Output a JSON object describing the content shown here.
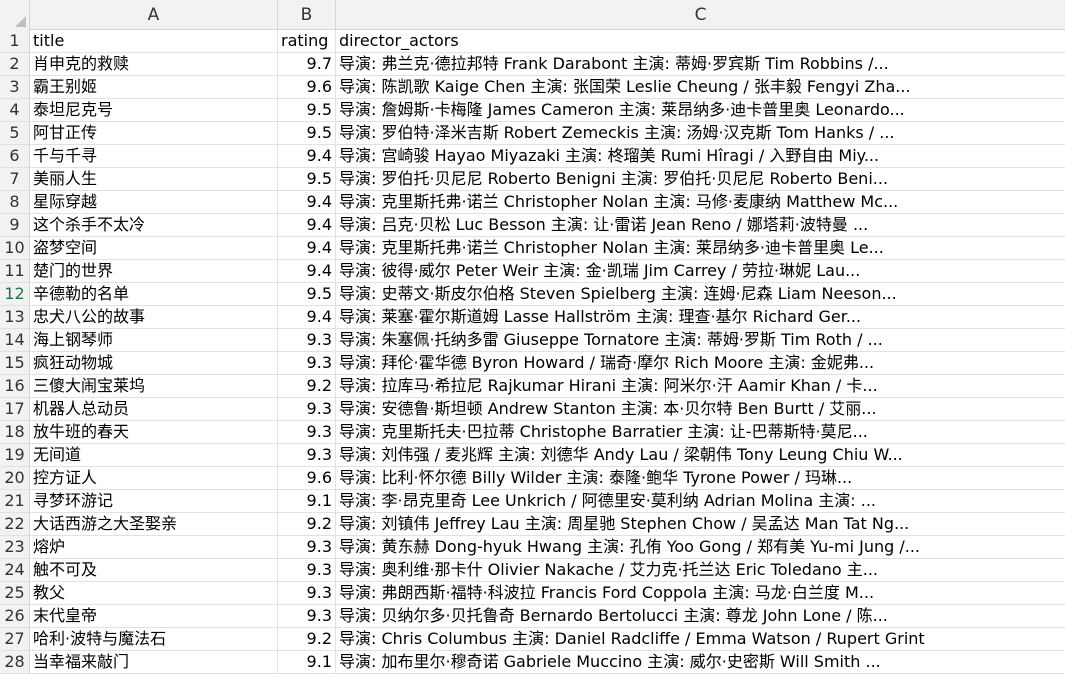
{
  "columns": [
    "A",
    "B",
    "C"
  ],
  "active_row": 12,
  "header_row": {
    "num": "1",
    "a": "title",
    "b": "rating",
    "c": "director_actors"
  },
  "rows": [
    {
      "num": "2",
      "a": "肖申克的救赎",
      "b": "9.7",
      "c": "导演: 弗兰克·德拉邦特 Frank Darabont   主演: 蒂姆·罗宾斯 Tim Robbins /..."
    },
    {
      "num": "3",
      "a": "霸王别姬",
      "b": "9.6",
      "c": "导演: 陈凯歌 Kaige Chen   主演: 张国荣 Leslie Cheung / 张丰毅 Fengyi Zha..."
    },
    {
      "num": "4",
      "a": "泰坦尼克号",
      "b": "9.5",
      "c": "导演: 詹姆斯·卡梅隆 James Cameron   主演: 莱昂纳多·迪卡普里奥 Leonardo..."
    },
    {
      "num": "5",
      "a": "阿甘正传",
      "b": "9.5",
      "c": "导演: 罗伯特·泽米吉斯 Robert Zemeckis   主演: 汤姆·汉克斯 Tom Hanks / ..."
    },
    {
      "num": "6",
      "a": "千与千寻",
      "b": "9.4",
      "c": "导演: 宫崎骏 Hayao Miyazaki   主演: 柊瑠美 Rumi Hîragi / 入野自由 Miy..."
    },
    {
      "num": "7",
      "a": "美丽人生",
      "b": "9.5",
      "c": "导演: 罗伯托·贝尼尼 Roberto Benigni   主演: 罗伯托·贝尼尼 Roberto Beni..."
    },
    {
      "num": "8",
      "a": "星际穿越",
      "b": "9.4",
      "c": "导演: 克里斯托弗·诺兰 Christopher Nolan   主演: 马修·麦康纳 Matthew Mc..."
    },
    {
      "num": "9",
      "a": "这个杀手不太冷",
      "b": "9.4",
      "c": "导演: 吕克·贝松 Luc Besson   主演: 让·雷诺 Jean Reno / 娜塔莉·波特曼 ..."
    },
    {
      "num": "10",
      "a": "盗梦空间",
      "b": "9.4",
      "c": "导演: 克里斯托弗·诺兰 Christopher Nolan   主演: 莱昂纳多·迪卡普里奥 Le..."
    },
    {
      "num": "11",
      "a": "楚门的世界",
      "b": "9.4",
      "c": "导演: 彼得·威尔 Peter Weir   主演: 金·凯瑞 Jim Carrey / 劳拉·琳妮 Lau..."
    },
    {
      "num": "12",
      "a": "辛德勒的名单",
      "b": "9.5",
      "c": "导演: 史蒂文·斯皮尔伯格 Steven Spielberg   主演: 连姆·尼森 Liam Neeson..."
    },
    {
      "num": "13",
      "a": "忠犬八公的故事",
      "b": "9.4",
      "c": "导演: 莱塞·霍尔斯道姆 Lasse Hallström   主演: 理查·基尔 Richard Ger..."
    },
    {
      "num": "14",
      "a": "海上钢琴师",
      "b": "9.3",
      "c": "导演: 朱塞佩·托纳多雷 Giuseppe Tornatore   主演: 蒂姆·罗斯 Tim Roth / ..."
    },
    {
      "num": "15",
      "a": "疯狂动物城",
      "b": "9.3",
      "c": "导演: 拜伦·霍华德 Byron Howard / 瑞奇·摩尔 Rich Moore   主演: 金妮弗..."
    },
    {
      "num": "16",
      "a": "三傻大闹宝莱坞",
      "b": "9.2",
      "c": "导演: 拉库马·希拉尼 Rajkumar Hirani   主演: 阿米尔·汗 Aamir Khan / 卡..."
    },
    {
      "num": "17",
      "a": "机器人总动员",
      "b": "9.3",
      "c": "导演: 安德鲁·斯坦顿 Andrew Stanton   主演: 本·贝尔特 Ben Burtt / 艾丽..."
    },
    {
      "num": "18",
      "a": "放牛班的春天",
      "b": "9.3",
      "c": "导演: 克里斯托夫·巴拉蒂 Christophe Barratier   主演: 让-巴蒂斯特·莫尼..."
    },
    {
      "num": "19",
      "a": "无间道",
      "b": "9.3",
      "c": "导演: 刘伟强 / 麦兆辉   主演: 刘德华 Andy Lau / 梁朝伟 Tony Leung Chiu W..."
    },
    {
      "num": "20",
      "a": "控方证人",
      "b": "9.6",
      "c": "导演: 比利·怀尔德 Billy Wilder   主演: 泰隆·鲍华 Tyrone Power / 玛琳..."
    },
    {
      "num": "21",
      "a": "寻梦环游记",
      "b": "9.1",
      "c": "导演: 李·昂克里奇 Lee Unkrich / 阿德里安·莫利纳 Adrian Molina   主演: ..."
    },
    {
      "num": "22",
      "a": "大话西游之大圣娶亲",
      "b": "9.2",
      "c": "导演: 刘镇伟 Jeffrey Lau   主演: 周星驰 Stephen Chow / 吴孟达 Man Tat Ng..."
    },
    {
      "num": "23",
      "a": "熔炉",
      "b": "9.3",
      "c": "导演: 黄东赫 Dong-hyuk Hwang   主演: 孔侑 Yoo Gong / 郑有美 Yu-mi Jung /..."
    },
    {
      "num": "24",
      "a": "触不可及",
      "b": "9.3",
      "c": "导演: 奥利维·那卡什 Olivier Nakache / 艾力克·托兰达 Eric Toledano   主..."
    },
    {
      "num": "25",
      "a": "教父",
      "b": "9.3",
      "c": "导演: 弗朗西斯·福特·科波拉 Francis Ford Coppola   主演: 马龙·白兰度 M..."
    },
    {
      "num": "26",
      "a": "末代皇帝",
      "b": "9.3",
      "c": "导演: 贝纳尔多·贝托鲁奇 Bernardo Bertolucci   主演: 尊龙 John Lone / 陈..."
    },
    {
      "num": "27",
      "a": "哈利·波特与魔法石",
      "b": "9.2",
      "c": "导演: Chris Columbus   主演: Daniel Radcliffe / Emma Watson / Rupert Grint"
    },
    {
      "num": "28",
      "a": "当幸福来敲门",
      "b": "9.1",
      "c": "导演: 加布里尔·穆奇诺 Gabriele Muccino   主演: 威尔·史密斯 Will Smith ..."
    }
  ]
}
